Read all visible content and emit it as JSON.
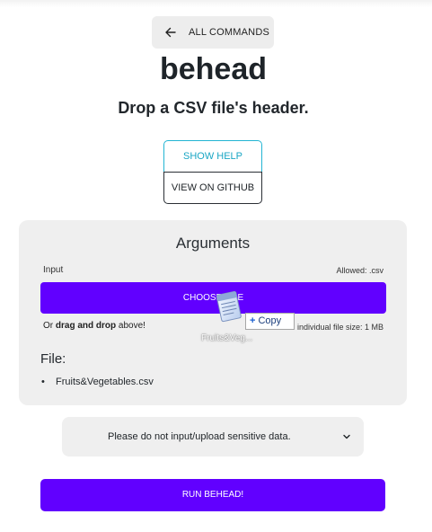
{
  "header": {
    "back_label": "ALL COMMANDS",
    "title": "behead",
    "subtitle": "Drop a CSV file's header."
  },
  "actions": {
    "help_label": "SHOW HELP",
    "github_label": "VIEW ON GITHUB"
  },
  "arguments": {
    "title": "Arguments",
    "input_label": "Input",
    "allowed": "Allowed: .csv",
    "choose_label": "CHOOSE FILE",
    "drop_hint_prefix": "Or ",
    "drop_hint_bold": "drag and drop",
    "drop_hint_suffix": " above!",
    "max_size": "individual file size: 1 MB",
    "file_heading": "File:",
    "files": [
      "Fruits&Vegetables.csv"
    ]
  },
  "drag_overlay": {
    "file_name": "Fruits&Veg...",
    "copy_label": "Copy"
  },
  "notice": {
    "text": "Please do not input/upload sensitive data."
  },
  "run": {
    "label": "RUN BEHEAD!"
  },
  "colors": {
    "accent": "#6100ff",
    "help": "#23b5d3",
    "panel": "#efefef"
  }
}
